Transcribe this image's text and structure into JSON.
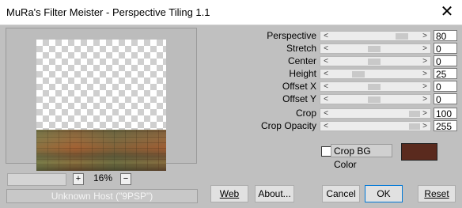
{
  "window": {
    "title": "MuRa's Filter Meister - Perspective Tiling 1.1",
    "close_glyph": "✕"
  },
  "zoom": {
    "plus": "+",
    "value": "16%",
    "minus": "−"
  },
  "status": "Unknown Host (\"9PSP\")",
  "params": [
    {
      "label": "Perspective",
      "value": "80"
    },
    {
      "label": "Stretch",
      "value": "0"
    },
    {
      "label": "Center",
      "value": "0"
    },
    {
      "label": "Height",
      "value": "25"
    },
    {
      "label": "Offset X",
      "value": "0"
    },
    {
      "label": "Offset Y",
      "value": "0"
    },
    {
      "label": "Crop",
      "value": "100"
    },
    {
      "label": "Crop Opacity",
      "value": "255"
    }
  ],
  "arrows": {
    "left": "<",
    "right": ">"
  },
  "crop_bg": {
    "label": "Crop BG Color",
    "checked": false,
    "color": "#5a2a1e"
  },
  "buttons": {
    "web": "Web",
    "about": "About...",
    "cancel": "Cancel",
    "ok": "OK",
    "reset": "Reset"
  }
}
